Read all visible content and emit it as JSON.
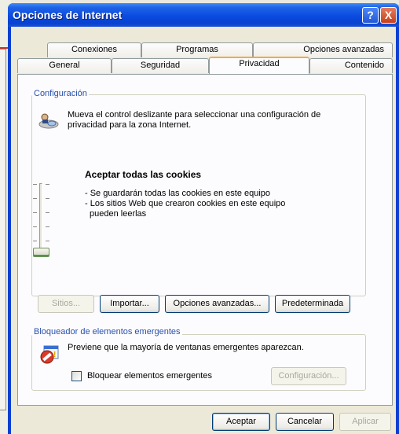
{
  "window": {
    "title": "Opciones de Internet",
    "help_glyph": "?",
    "close_glyph": "X"
  },
  "tabs": {
    "row1": [
      {
        "label": "Conexiones"
      },
      {
        "label": "Programas"
      },
      {
        "label": "Opciones avanzadas"
      }
    ],
    "row2": [
      {
        "label": "General"
      },
      {
        "label": "Seguridad"
      },
      {
        "label": "Privacidad",
        "active": true
      },
      {
        "label": "Contenido"
      }
    ]
  },
  "config": {
    "group_label": "Configuración",
    "description_line1": "Mueva el control deslizante para seleccionar una configuración de",
    "description_line2": "privacidad para la zona Internet.",
    "level_title": "Aceptar todas las cookies",
    "level_desc_line1": "- Se guardarán todas las cookies en este equipo",
    "level_desc_line2": "- Los sitios Web que crearon cookies en este equipo",
    "level_desc_line3": "pueden leerlas",
    "slider_level": 0,
    "buttons": {
      "sites": "Sitios...",
      "import": "Importar...",
      "advanced": "Opciones avanzadas...",
      "default": "Predeterminada"
    }
  },
  "popup": {
    "group_label": "Bloqueador de elementos emergentes",
    "description": "Previene que la mayoría de ventanas emergentes aparezcan.",
    "checkbox_label": "Bloquear elementos emergentes",
    "checkbox_checked": false,
    "settings_button": "Configuración..."
  },
  "footer": {
    "accept": "Aceptar",
    "cancel": "Cancelar",
    "apply": "Aplicar"
  },
  "colors": {
    "titlebar": "#0a4be0",
    "group_label": "#2850ae",
    "active_tab_accent": "#f5a843"
  }
}
